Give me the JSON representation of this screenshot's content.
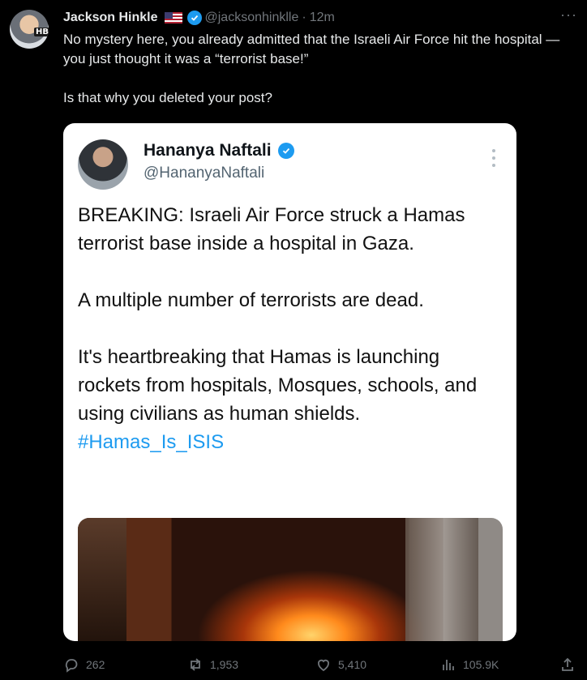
{
  "tweet": {
    "author_name": "Jackson Hinkle",
    "author_handle": "@jacksonhinklle",
    "separator": "·",
    "time": "12m",
    "avatar_badge": "HB",
    "text": "No mystery here, you already admitted that the Israeli Air Force hit the hospital — you just thought it was a “terrorist base!”\n\nIs that why you deleted your post?",
    "more_label": "···"
  },
  "quoted": {
    "author_name": "Hananya Naftali",
    "author_handle": "@HananyaNaftali",
    "text_main": "BREAKING: Israeli Air Force struck a Hamas terrorist base inside a hospital in Gaza.\n\nA multiple number of terrorists are dead.\n\nIt's heartbreaking that Hamas is launching rockets from hospitals, Mosques, schools, and using civilians as human shields. ",
    "hashtag": "#Hamas_Is_ISIS"
  },
  "actions": {
    "replies": "262",
    "reposts": "1,953",
    "likes": "5,410",
    "views": "105.9K"
  },
  "colors": {
    "background": "#000000",
    "text": "#e7e9ea",
    "muted": "#71767b",
    "accent": "#1d9bf0"
  }
}
